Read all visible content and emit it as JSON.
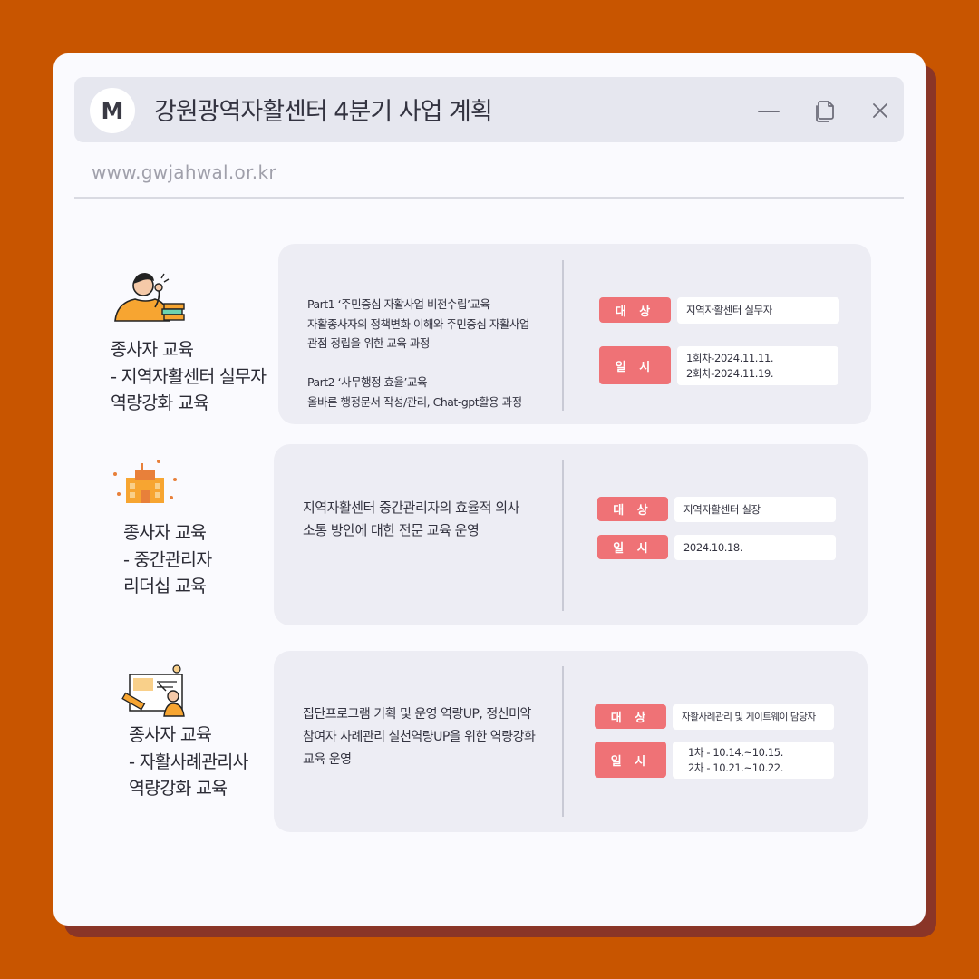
{
  "window": {
    "avatar_letter": "M",
    "title": "강원광역자활센터 4분기 사업 계획",
    "url": "www.gwjahwal.or.kr",
    "controls": {
      "minimize_icon": "minimize-icon",
      "restore_icon": "restore-icon",
      "close_icon": "close-icon"
    }
  },
  "colors": {
    "background": "#c85500",
    "shadow": "#8a3527",
    "badge": "#ef7276",
    "panel": "#ededf4"
  },
  "sections": [
    {
      "icon": "worker-with-books-illustration",
      "label": [
        "종사자 교육",
        "- 지역자활센터 실무자",
        "역량강화 교육"
      ],
      "description": [
        "Part1 ‘주민중심 자활사업 비전수립’교육",
        "자활종사자의 정책변화 이해와 주민중심 자활사업",
        "관점 정립을 위한 교육 과정",
        "",
        "Part2 ‘사무행정 효율’교육",
        "올바른 행정문서 작성/관리, Chat-gpt활용 과정"
      ],
      "target_label": "대 상",
      "target": "지역자활센터 실무자",
      "date_label": "일 시",
      "date_lines": [
        "1회차-2024.11.11.",
        "2회차-2024.11.19."
      ]
    },
    {
      "icon": "building-illustration",
      "label": [
        "종사자 교육",
        "- 중간관리자",
        "리더십 교육"
      ],
      "description": [
        "지역자활센터 중간관리자의 효율적 의사",
        "소통 방안에 대한 전문 교육 운영"
      ],
      "target_label": "대 상",
      "target": "지역자활센터 실장",
      "date_label": "일 시",
      "date_lines": [
        "2024.10.18."
      ]
    },
    {
      "icon": "presenter-illustration",
      "label": [
        "종사자 교육",
        "- 자활사례관리사",
        "역량강화 교육"
      ],
      "description": [
        "집단프로그램 기획 및 운영 역량UP, 정신미약",
        "참여자 사례관리 실천역량UP을 위한 역량강화",
        "교육 운영"
      ],
      "target_label": "대 상",
      "target": "자활사례관리 및 게이트웨이 담당자",
      "date_label": "일 시",
      "date_lines": [
        "1차 - 10.14.~10.15.",
        "2차 - 10.21.~10.22."
      ]
    }
  ]
}
